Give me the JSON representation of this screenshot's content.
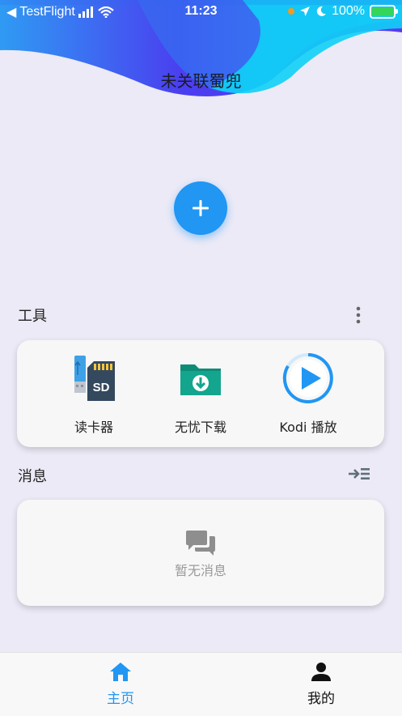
{
  "status_bar": {
    "back_app": "TestFlight",
    "time": "11:23",
    "battery": "100%"
  },
  "device": {
    "title": "未关联蜀兜"
  },
  "tools": {
    "title": "工具",
    "items": [
      {
        "label": "读卡器",
        "icon": "sd-card-reader-icon"
      },
      {
        "label": "无忧下载",
        "icon": "download-folder-icon"
      },
      {
        "label": "Kodi 播放",
        "icon": "play-circle-icon"
      }
    ]
  },
  "messages": {
    "title": "消息",
    "empty_text": "暂无消息"
  },
  "nav": {
    "home": "主页",
    "mine": "我的"
  },
  "colors": {
    "accent": "#2196f3",
    "background": "#eceaf6",
    "card": "#f7f7f7",
    "header_gradient_start": "#4a3ff0",
    "header_gradient_end": "#14c8f5"
  }
}
